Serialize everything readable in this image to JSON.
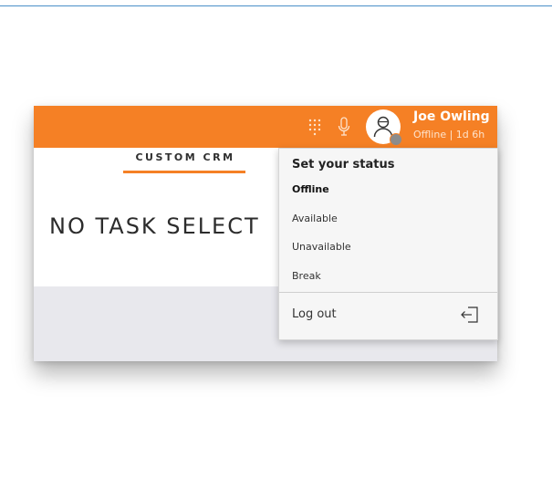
{
  "header": {
    "user_name": "Joe Owling",
    "user_status": "Offline | 1d 6h"
  },
  "icons": {
    "dialpad": "dialpad-icon",
    "microphone": "microphone-icon",
    "avatar": "user-avatar-icon",
    "logout": "logout-icon"
  },
  "tabs": {
    "active_label": "CUSTOM CRM"
  },
  "main": {
    "placeholder": "NO TASK SELECT"
  },
  "status_menu": {
    "title": "Set your status",
    "items": [
      {
        "label": "Offline",
        "selected": true
      },
      {
        "label": "Available",
        "selected": false
      },
      {
        "label": "Unavailable",
        "selected": false
      },
      {
        "label": "Break",
        "selected": false
      }
    ],
    "logout_label": "Log out"
  },
  "colors": {
    "brand_orange": "#f58025",
    "status_offline": "#8c8c8c",
    "menu_background": "#f6f6f6"
  }
}
